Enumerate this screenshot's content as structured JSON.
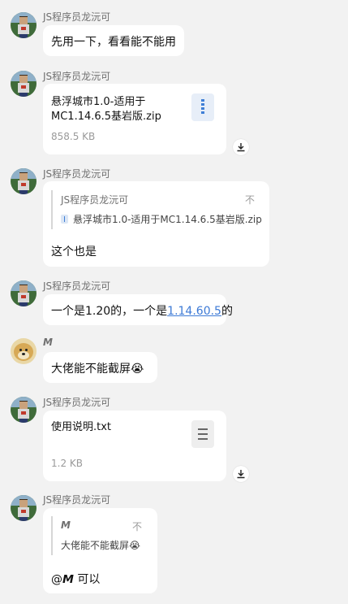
{
  "messages": [
    {
      "sender": "JS程序员龙沅可",
      "text": "先用一下，看看能不能用"
    },
    {
      "sender": "JS程序员龙沅可",
      "file": {
        "name": "悬浮城市1.0-适用于MC1.14.6.5基岩版.zip",
        "size": "858.5 KB",
        "icon": "zip-icon"
      }
    },
    {
      "sender": "JS程序员龙沅可",
      "quote": {
        "name": "JS程序员龙沅可",
        "mark": "不",
        "text": "悬浮城市1.0-适用于MC1.14.6.5基岩版.zip"
      },
      "text": "这个也是"
    },
    {
      "sender": "JS程序员龙沅可",
      "text_before": "一个是1.20的，一个是",
      "link": "1.14.60.5",
      "text_after": "的"
    },
    {
      "sender": "𝙈",
      "text": "大佬能不能截屏",
      "emoji": "😭"
    },
    {
      "sender": "JS程序员龙沅可",
      "file": {
        "name": "使用说明.txt",
        "size": "1.2 KB",
        "icon": "txt-icon"
      }
    },
    {
      "sender": "JS程序员龙沅可",
      "quote": {
        "name": "𝙈",
        "mark": "不",
        "text": "大佬能不能截屏😭"
      },
      "text": "@𝙈 可以"
    }
  ]
}
